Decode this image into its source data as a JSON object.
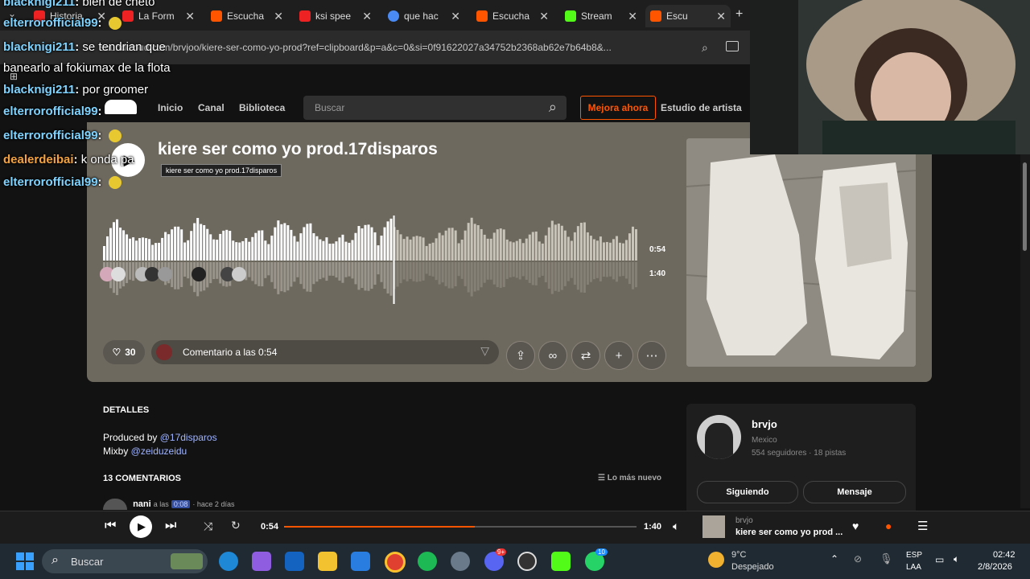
{
  "browser": {
    "tabs": [
      {
        "label": "Historia",
        "color": "#e22"
      },
      {
        "label": "La Form",
        "color": "#e22"
      },
      {
        "label": "Escucha",
        "color": "#f50"
      },
      {
        "label": "ksi spee",
        "color": "#e22"
      },
      {
        "label": "que hac",
        "color": "#4a8af4"
      },
      {
        "label": "Escucha",
        "color": "#f50"
      },
      {
        "label": "Stream",
        "color": "#53fc18"
      },
      {
        "label": "Escu",
        "color": "#f50"
      }
    ],
    "url": "soundcloud.com/brvjoo/kiere-ser-como-yo-prod?ref=clipboard&p=a&c=0&si=0f91622027a34752b2368ab62e7b64b8&..."
  },
  "chat": [
    {
      "user": "blacknigi211",
      "msg": "bien de cheto",
      "emote": false
    },
    {
      "user": "elterrorofficial99",
      "msg": "",
      "emote": true
    },
    {
      "user": "blacknigi211",
      "msg": "se tendrian que",
      "emote": false
    },
    {
      "user": "",
      "msg": "banearlo al fokiumax de la flota",
      "emote": false
    },
    {
      "user": "blacknigi211",
      "msg": "por groomer",
      "emote": false
    },
    {
      "user": "elterrorofficial99",
      "msg": "",
      "emote": false
    },
    {
      "user": "elterrorofficial99",
      "msg": "",
      "emote": true
    },
    {
      "user": "dealerdeibai",
      "msg": "k onda pa",
      "emote": false
    },
    {
      "user": "elterrorofficial99",
      "msg": "",
      "emote": true
    }
  ],
  "nav": {
    "home": "Inicio",
    "feed": "Canal",
    "library": "Biblioteca",
    "search_placeholder": "Buscar",
    "upgrade": "Mejora ahora",
    "artist_studio": "Estudio de artista"
  },
  "track": {
    "title": "kiere ser como yo prod.17disparos",
    "tooltip": "kiere ser como yo prod.17disparos",
    "time_current": "0:54",
    "time_total": "1:40",
    "likes": "30",
    "comment_placeholder": "Comentario a las 0:54"
  },
  "details": {
    "heading": "DETALLES",
    "produced_label": "Produced by ",
    "producer": "@17disparos",
    "mix_label": "Mixby ",
    "mixer": "@zeiduzeidu",
    "comments_heading": "13 COMENTARIOS",
    "sort": "Lo más nuevo",
    "first_comment_user": "nani",
    "first_comment_at": "a las",
    "first_comment_time": "0:08",
    "first_comment_age": "· hace 2 días"
  },
  "artist": {
    "name": "brvjo",
    "country": "Mexico",
    "stats": "554 seguidores · 18 pistas",
    "following": "Siguiendo",
    "message": "Mensaje"
  },
  "player": {
    "current": "0:54",
    "total": "1:40",
    "progress": 0.54,
    "artist": "brvjo",
    "title": "kiere ser como yo prod ..."
  },
  "taskbar": {
    "search": "Buscar",
    "weather_temp": "9°C",
    "weather_desc": "Despejado",
    "lang1": "ESP",
    "lang2": "LAA",
    "time": "02:42",
    "date": "2/8/2026",
    "whatsapp_badge": "10",
    "discord_badge": "9+"
  },
  "colors": {
    "accent": "#ff5500",
    "hero_bg": "#6e695f"
  }
}
